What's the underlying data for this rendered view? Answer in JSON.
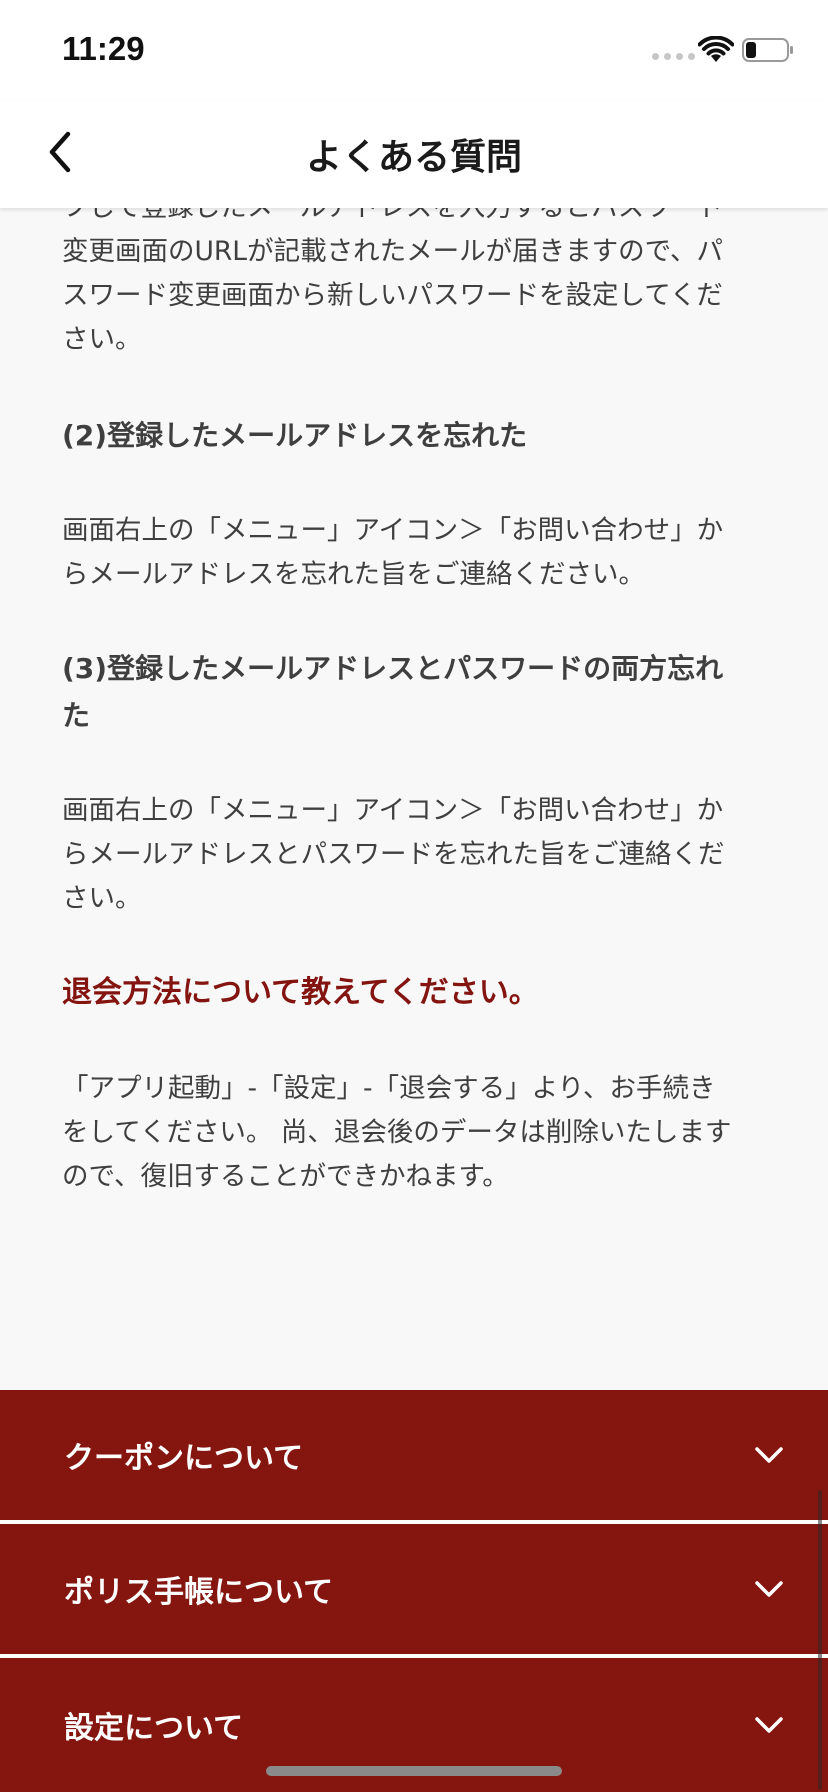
{
  "status_bar": {
    "time": "11:29"
  },
  "header": {
    "title": "よくある質問",
    "back_icon": "chevron-left-icon"
  },
  "content": {
    "partial_lines": [
      "フして登録したメールアドレスを入力するとパスワード",
      "変更画面のURLが記載されたメールが届きますので、パ",
      "スワード変更画面から新しいパスワードを設定してくだ",
      "さい。"
    ],
    "sub2_heading": "(2)登録したメールアドレスを忘れた",
    "sub2_body_lines": [
      "画面右上の「メニュー」アイコン＞「お問い合わせ」か",
      "らメールアドレスを忘れた旨をご連絡ください。"
    ],
    "sub3_heading_lines": [
      "(3)登録したメールアドレスとパスワードの両方忘れ",
      "た"
    ],
    "sub3_body_lines": [
      "画面右上の「メニュー」アイコン＞「お問い合わせ」か",
      "らメールアドレスとパスワードを忘れた旨をご連絡くだ",
      "さい。"
    ],
    "question": "退会方法について教えてください。",
    "answer_lines": [
      "「アプリ起動」-「設定」-「退会する」より、お手続き",
      "をしてください。 尚、退会後のデータは削除いたします",
      "ので、復旧することができかねます。"
    ]
  },
  "accordion": {
    "items": [
      {
        "label": "クーポンについて",
        "icon": "chevron-down-icon"
      },
      {
        "label": "ポリス手帳について",
        "icon": "chevron-down-icon"
      },
      {
        "label": "設定について",
        "icon": "chevron-down-icon"
      }
    ]
  },
  "colors": {
    "accent": "#85150f",
    "question_text": "#84140f",
    "body_text": "#3f3f3f",
    "background": "#f8f8f8"
  }
}
